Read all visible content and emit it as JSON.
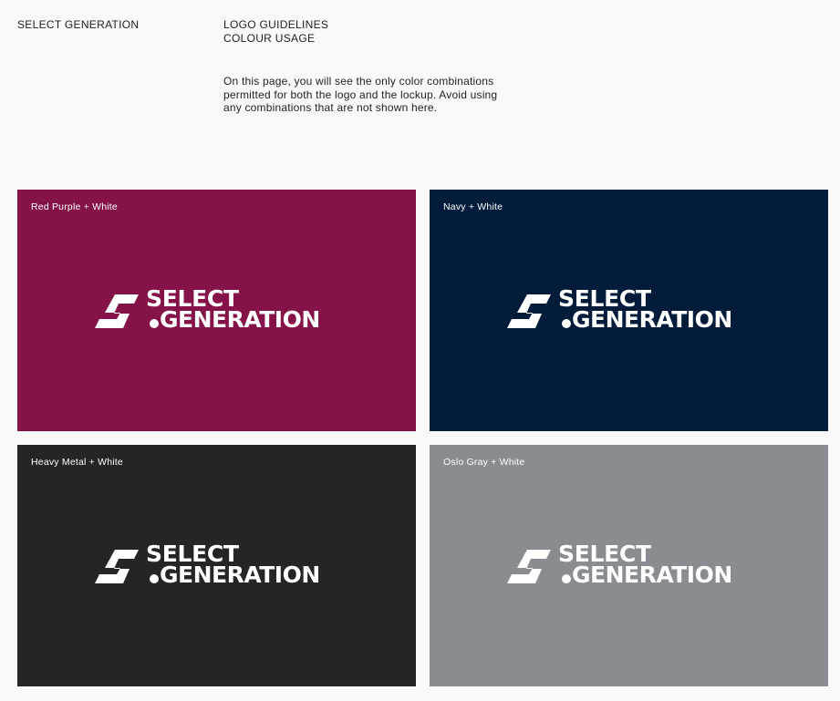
{
  "header": {
    "brand": "SELECT GENERATION",
    "section_line1": "LOGO GUIDELINES",
    "section_line2": "COLOUR USAGE"
  },
  "intro": {
    "text": "On this page, you will see the only color combinations permitted for both the logo and the lockup. Avoid using any combinations that are not shown here."
  },
  "logo": {
    "line1": "SELECT",
    "line2": "GENERATION",
    "icon": "select-generation-mark-icon"
  },
  "swatches": [
    {
      "label": "Red Purple + White",
      "background": "#851349",
      "foreground": "#ffffff"
    },
    {
      "label": "Navy + White",
      "background": "#011c3a",
      "foreground": "#ffffff"
    },
    {
      "label": "Heavy Metal + White",
      "background": "#252525",
      "foreground": "#ffffff"
    },
    {
      "label": "Oslo Gray + White",
      "background": "#898c91",
      "foreground": "#ffffff"
    }
  ]
}
